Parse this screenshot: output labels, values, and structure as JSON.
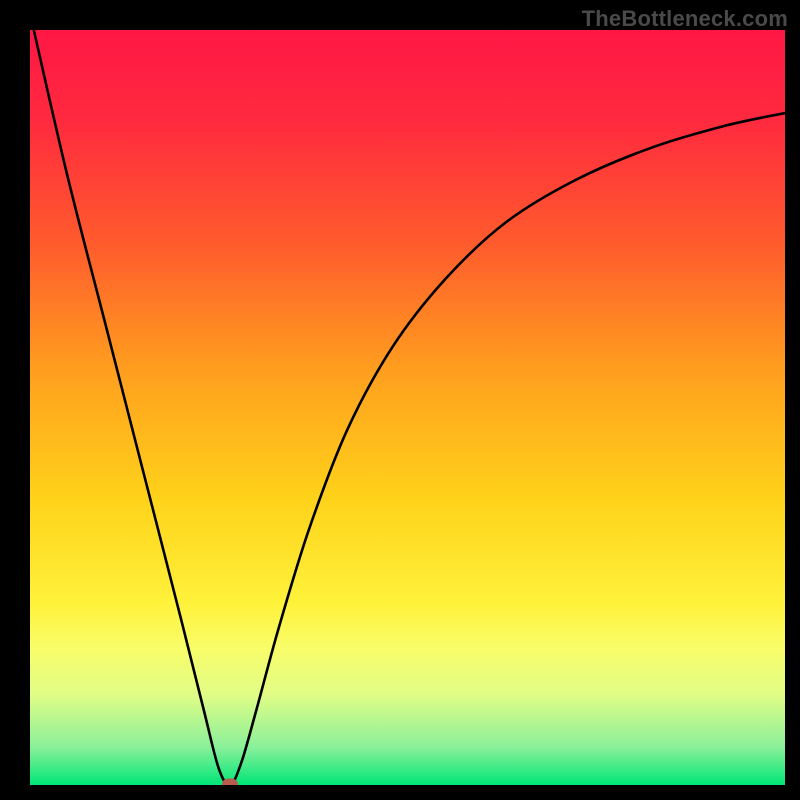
{
  "watermark": "TheBottleneck.com",
  "chart_data": {
    "type": "line",
    "title": "",
    "xlabel": "",
    "ylabel": "",
    "xlim": [
      0,
      100
    ],
    "ylim": [
      0,
      100
    ],
    "background_gradient_stops": [
      {
        "offset": 0,
        "color": "#ff1744"
      },
      {
        "offset": 12,
        "color": "#ff2a3f"
      },
      {
        "offset": 28,
        "color": "#ff5a2d"
      },
      {
        "offset": 45,
        "color": "#ff9e1e"
      },
      {
        "offset": 62,
        "color": "#ffd21a"
      },
      {
        "offset": 76,
        "color": "#fff23b"
      },
      {
        "offset": 82,
        "color": "#f8fd6a"
      },
      {
        "offset": 88,
        "color": "#e1fd86"
      },
      {
        "offset": 95,
        "color": "#8af09a"
      },
      {
        "offset": 100,
        "color": "#00e676"
      }
    ],
    "series": [
      {
        "name": "bottleneck-curve",
        "x": [
          0.5,
          5,
          10,
          15,
          20,
          23,
          25,
          26.5,
          28,
          30,
          33,
          37,
          42,
          48,
          55,
          63,
          72,
          82,
          92,
          100
        ],
        "y": [
          100,
          80.5,
          61,
          41.5,
          22,
          10,
          2.2,
          0,
          3,
          10,
          21,
          34,
          47,
          58,
          67,
          74.5,
          80,
          84.3,
          87.3,
          89
        ],
        "stroke": "#000000",
        "stroke_width": 2.6
      }
    ],
    "markers": [
      {
        "name": "optimum-point",
        "x": 26.5,
        "y": 0,
        "color": "#b85c4f"
      }
    ],
    "grid": false,
    "legend": false
  }
}
